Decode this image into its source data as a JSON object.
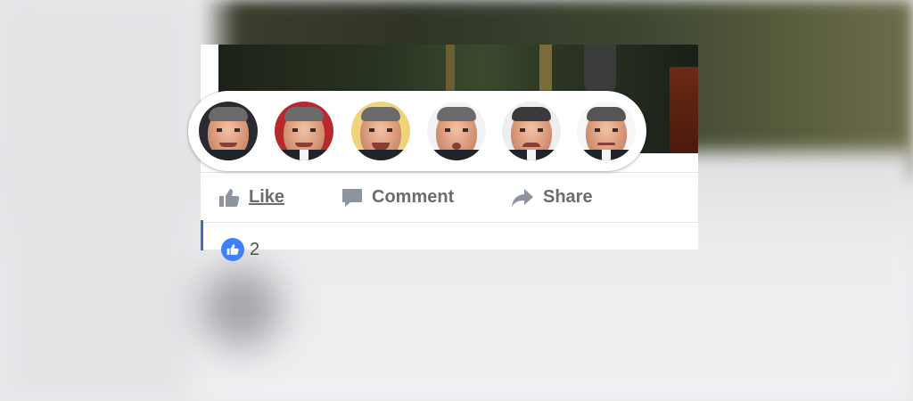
{
  "post": {
    "actions": [
      {
        "label": "Like",
        "icon": "thumbs-up-icon"
      },
      {
        "label": "Comment",
        "icon": "comment-icon"
      },
      {
        "label": "Share",
        "icon": "share-icon"
      }
    ],
    "reaction_count": "2"
  },
  "reactions_popup": {
    "items": [
      {
        "name": "like",
        "bg": "#2b2a30"
      },
      {
        "name": "love",
        "bg": "#b8282c"
      },
      {
        "name": "haha",
        "bg": "#efd27a"
      },
      {
        "name": "wow",
        "bg": "#f3f3f3"
      },
      {
        "name": "sad",
        "bg": "#eeeeee"
      },
      {
        "name": "angry",
        "bg": "#f6f6f6"
      }
    ]
  },
  "colors": {
    "accent": "#4080ff",
    "action_text": "#6a6c70"
  }
}
